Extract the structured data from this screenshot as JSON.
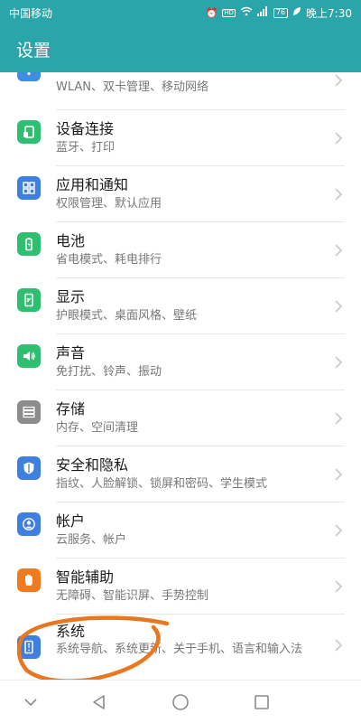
{
  "status_bar": {
    "carrier": "中国移动",
    "time": "晚上7:30",
    "battery_level": "76",
    "network_type": "4G"
  },
  "app_bar": {
    "title": "设置"
  },
  "settings_items": [
    {
      "title": "",
      "subtitle": "WLAN、双卡管理、移动网络",
      "icon": "network-icon",
      "color": "#3f8ce0"
    },
    {
      "title": "设备连接",
      "subtitle": "蓝牙、打印",
      "icon": "device-connection-icon",
      "color": "#2fbf71"
    },
    {
      "title": "应用和通知",
      "subtitle": "权限管理、默认应用",
      "icon": "apps-icon",
      "color": "#3f7fe0"
    },
    {
      "title": "电池",
      "subtitle": "省电模式、耗电排行",
      "icon": "battery-icon",
      "color": "#2fbf71"
    },
    {
      "title": "显示",
      "subtitle": "护眼模式、桌面风格、壁纸",
      "icon": "display-icon",
      "color": "#2fbf71"
    },
    {
      "title": "声音",
      "subtitle": "免打扰、铃声、振动",
      "icon": "sound-icon",
      "color": "#2fbf71"
    },
    {
      "title": "存储",
      "subtitle": "内存、空间清理",
      "icon": "storage-icon",
      "color": "#8c8c8c"
    },
    {
      "title": "安全和隐私",
      "subtitle": "指纹、人脸解锁、锁屏和密码、学生模式",
      "icon": "shield-icon",
      "color": "#3f7fe0"
    },
    {
      "title": "帐户",
      "subtitle": "云服务、帐户",
      "icon": "account-icon",
      "color": "#3f7fe0"
    },
    {
      "title": "智能辅助",
      "subtitle": "无障碍、智能识屏、手势控制",
      "icon": "hand-icon",
      "color": "#f07a1f"
    },
    {
      "title": "系统",
      "subtitle": "系统导航、系统更新、关于手机、语言和输入法",
      "icon": "system-icon",
      "color": "#3f7fe0"
    }
  ],
  "annotation": {
    "circled_item": "系统",
    "color": "#e8771f"
  },
  "colors": {
    "accent": "#2aa5a9"
  }
}
